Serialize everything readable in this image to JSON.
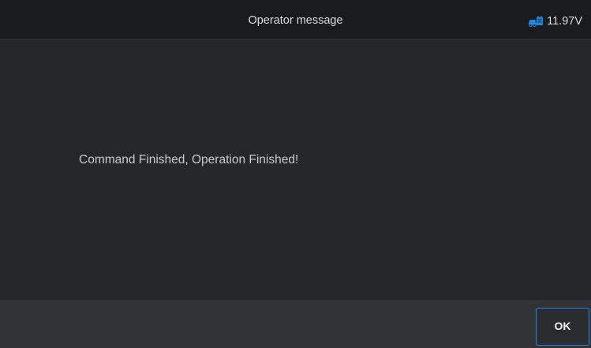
{
  "header": {
    "title": "Operator message",
    "voltage_icon": "vehicle-battery-icon",
    "voltage": "11.97V",
    "accent_color": "#1e88e5"
  },
  "content": {
    "message": "Command Finished, Operation Finished!"
  },
  "footer": {
    "ok_label": "OK"
  }
}
